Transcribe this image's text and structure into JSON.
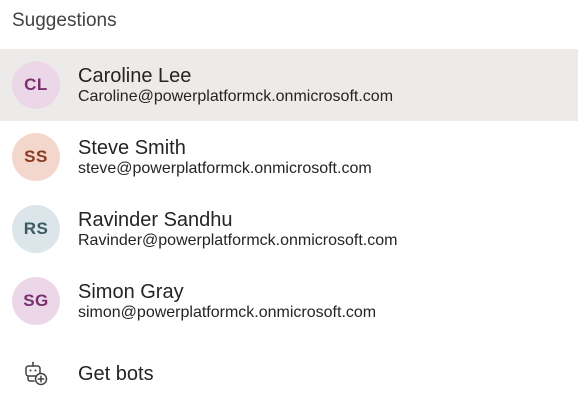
{
  "header": {
    "title": "Suggestions"
  },
  "suggestions": [
    {
      "initials": "CL",
      "name": "Caroline Lee",
      "email": "Caroline@powerplatformck.onmicrosoft.com",
      "avatar_bg": "#ecd7e8",
      "avatar_fg": "#7a2f6e",
      "selected": true
    },
    {
      "initials": "SS",
      "name": "Steve Smith",
      "email": "steve@powerplatformck.onmicrosoft.com",
      "avatar_bg": "#f3d6cc",
      "avatar_fg": "#8a3b22",
      "selected": false
    },
    {
      "initials": "RS",
      "name": "Ravinder Sandhu",
      "email": "Ravinder@powerplatformck.onmicrosoft.com",
      "avatar_bg": "#dbe5ea",
      "avatar_fg": "#3c5a66",
      "selected": false
    },
    {
      "initials": "SG",
      "name": "Simon Gray",
      "email": "simon@powerplatformck.onmicrosoft.com",
      "avatar_bg": "#ecd7e8",
      "avatar_fg": "#7a2f6e",
      "selected": false
    }
  ],
  "get_bots": {
    "label": "Get bots",
    "icon": "bot-add-icon"
  }
}
